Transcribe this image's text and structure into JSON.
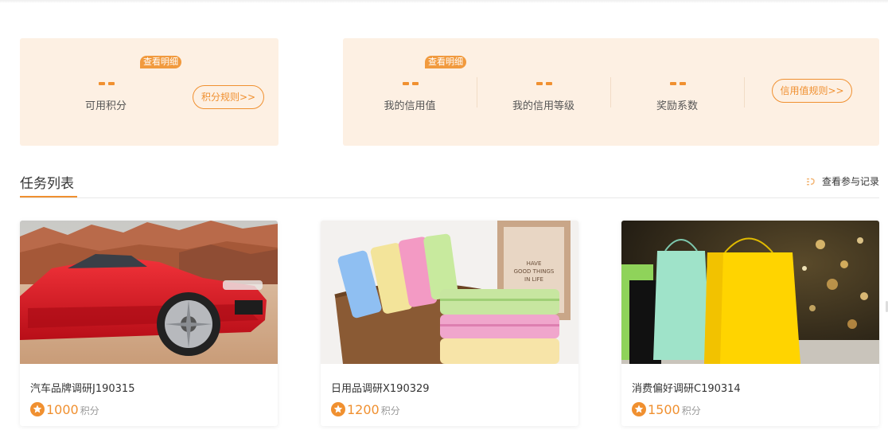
{
  "points_panel": {
    "detail_badge": "查看明细",
    "value": "--",
    "label": "可用积分",
    "rules_button": "积分规则>>"
  },
  "credit_panel": {
    "detail_badge": "查看明细",
    "stats": [
      {
        "value": "--",
        "label": "我的信用值"
      },
      {
        "value": "--",
        "label": "我的信用等级"
      },
      {
        "value": "--",
        "label": "奖励系数"
      }
    ],
    "rules_button": "信用值规则>>"
  },
  "task_section": {
    "title": "任务列表",
    "records_link": "查看参与记录",
    "records_icon": "records-icon"
  },
  "tasks": [
    {
      "title": "汽车品牌调研J190315",
      "points": "1000",
      "unit": "积分",
      "image": "red-sports-car-photo"
    },
    {
      "title": "日用品调研X190329",
      "points": "1200",
      "unit": "积分",
      "image": "towels-in-basket-photo"
    },
    {
      "title": "消费偏好调研C190314",
      "points": "1500",
      "unit": "积分",
      "image": "shopping-bags-photo"
    }
  ],
  "colors": {
    "accent": "#f09030",
    "panel_bg": "#fdf0e3",
    "badge": "#f19a3e"
  }
}
